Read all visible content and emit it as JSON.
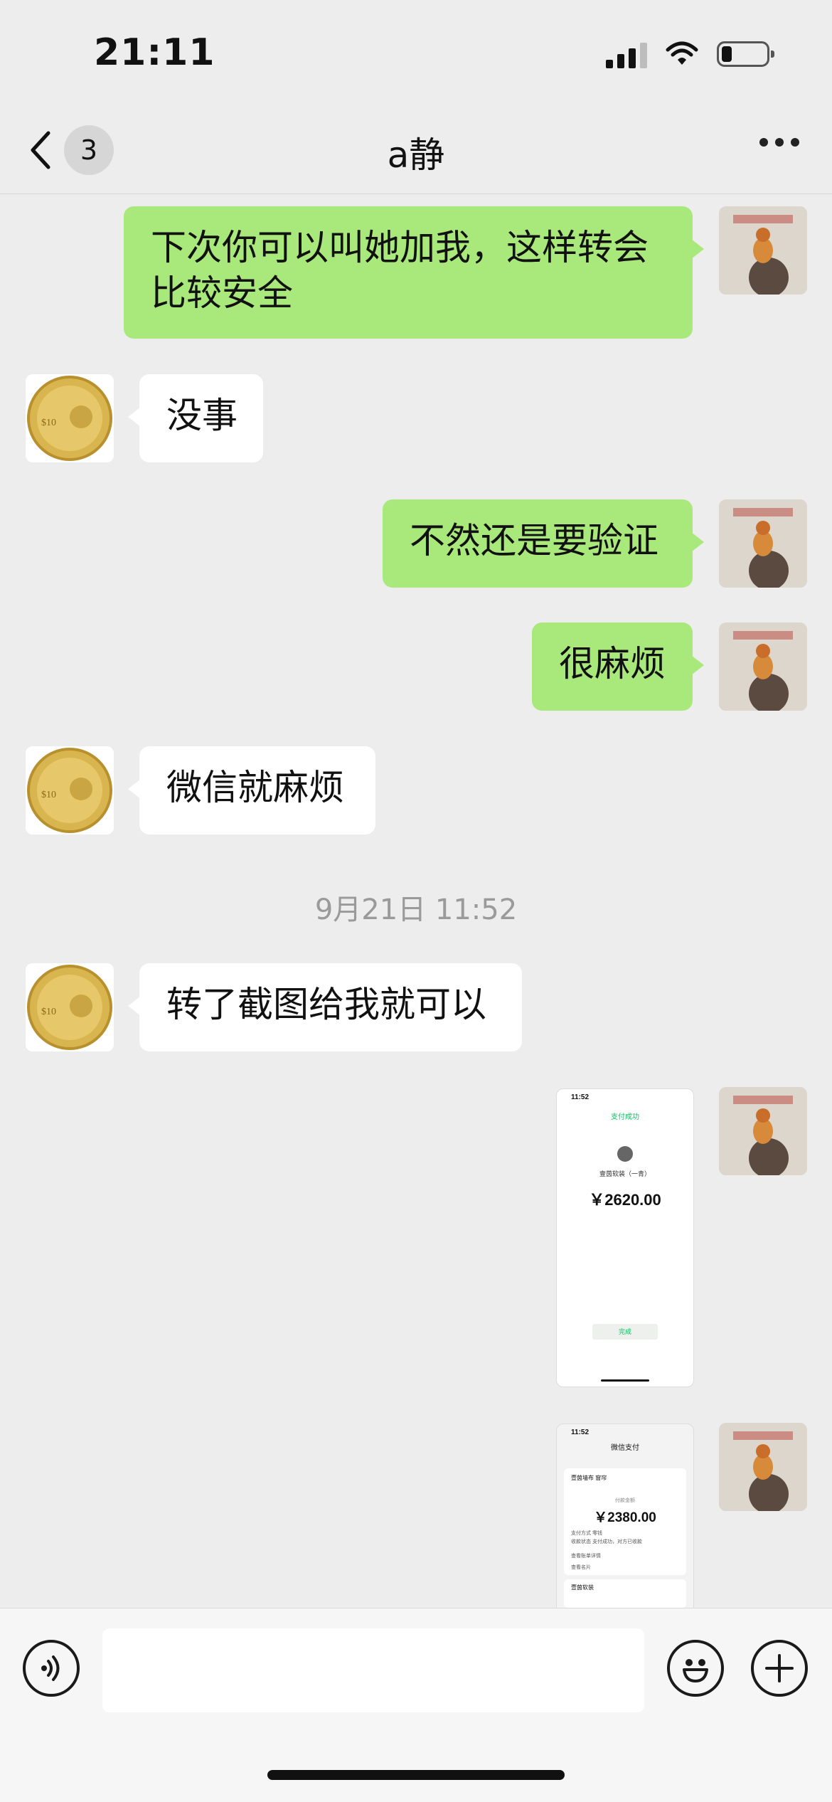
{
  "status_bar": {
    "time": "21:11"
  },
  "header": {
    "back_badge": "3",
    "title": "a静"
  },
  "messages": [
    {
      "id": "m1",
      "side": "me",
      "text": "下次你可以叫她加我，这样转会比较安全"
    },
    {
      "id": "m2",
      "side": "other",
      "text": "没事"
    },
    {
      "id": "m3",
      "side": "me",
      "text": "不然还是要验证"
    },
    {
      "id": "m4",
      "side": "me",
      "text": "很麻烦"
    },
    {
      "id": "m5",
      "side": "other",
      "text": "微信就麻烦"
    },
    {
      "id": "m6",
      "side": "other",
      "text": "转了截图给我就可以"
    }
  ],
  "timestamp": "9月21日 11:52",
  "screenshot_1": {
    "time": "11:52",
    "status": "支付成功",
    "payee": "壹茵软装（一青）",
    "amount": "￥2620.00",
    "done": "完成"
  },
  "screenshot_2": {
    "time": "11:52",
    "header": "微信支付",
    "merchant": "壹茵墙布 窗帘",
    "label": "付款金额",
    "amount": "￥2380.00",
    "row1": "支付方式  零钱",
    "row2": "收款状态  支付成功，对方已收款",
    "row3": "查看账单详情",
    "row4": "查看名片",
    "card2": "壹茵软装"
  },
  "input": {
    "placeholder": ""
  },
  "icons": {
    "back": "chevron-left-icon",
    "more": "more-dots-icon",
    "voice": "voice-icon",
    "emoji": "emoji-icon",
    "plus": "plus-icon"
  },
  "colors": {
    "bubble_me": "#a9e97c",
    "bubble_other": "#ffffff",
    "background": "#ededed"
  }
}
